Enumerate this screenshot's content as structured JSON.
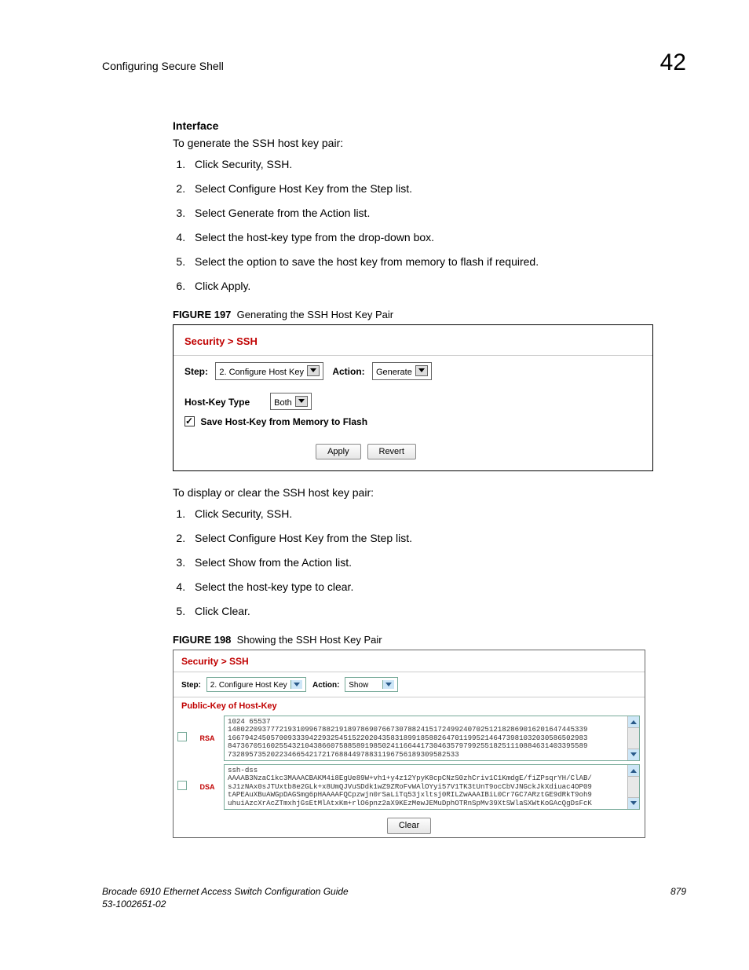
{
  "header": {
    "title": "Configuring Secure Shell",
    "chapter": "42"
  },
  "section": {
    "heading": "Interface",
    "intro1": "To generate the SSH host key pair:",
    "list1": [
      "Click Security, SSH.",
      "Select Configure Host Key from the Step list.",
      "Select Generate from the Action list.",
      "Select the host-key type from the drop-down box.",
      "Select the option to save the host key from memory to flash if required.",
      "Click Apply."
    ],
    "intro2": "To display or clear the SSH host key pair:",
    "list2": [
      "Click Security, SSH.",
      "Select Configure Host Key from the Step list.",
      "Select Show from the Action list.",
      "Select the host-key type to clear.",
      "Click Clear."
    ]
  },
  "figure197": {
    "label": "FIGURE 197",
    "caption": "Generating the SSH Host Key Pair",
    "breadcrumb": "Security > SSH",
    "step_label": "Step:",
    "step_value": "2. Configure Host Key",
    "action_label": "Action:",
    "action_value": "Generate",
    "hostkey_label": "Host-Key Type",
    "hostkey_value": "Both",
    "save_label": "Save Host-Key from Memory to Flash",
    "apply": "Apply",
    "revert": "Revert"
  },
  "figure198": {
    "label": "FIGURE 198",
    "caption": "Showing the SSH Host Key Pair",
    "breadcrumb": "Security > SSH",
    "step_label": "Step:",
    "step_value": "2. Configure Host Key",
    "action_label": "Action:",
    "action_value": "Show",
    "pk_heading": "Public-Key of Host-Key",
    "rsa_label": "RSA",
    "rsa_data": "1024 65537\n148022093777219310996788219189786907667307882415172499240702512182869016201647445339\n166794245057009333942293254515220204358318991858826470119952146473981032030586502983\n847367051602554321043866075885891985024116644173046357979925518251110884631403395589\n732895735202234665421721768844978831196756189309582533",
    "dsa_label": "DSA",
    "dsa_data": "ssh-dss\nAAAAB3NzaC1kc3MAAACBAKM4i8EgUe89W+vh1+y4z12YpyK8cpCNzS0zhCriv1C1KmdgE/fiZPsqrYH/ClAB/\nsJ1zNAx0sJTUxtb8e2GLk+x8UmQJVuSDdk1wZ9ZRoFvWAlOYyi57V1TK3tUnT9ocCbVJNGckJkXdiuac4OP09\ntAPEAuXBuAWGpDAGSmg6pHAAAAFQCpzwjn0rSaLiTq53jxltsj0RILZwAAAIBiL0Cr7GC7ARztGE9dRkT9oh9\nuhuiAzcXrAcZTmxhjGsEtMlAtxKm+rlO6pnz2aX9KEzMewJEMuDphOTRnSpMv39XtSWlaSXWtKoGAcQgDsFcK",
    "clear": "Clear"
  },
  "footer": {
    "left1": "Brocade 6910 Ethernet Access Switch Configuration Guide",
    "left2": "53-1002651-02",
    "page": "879"
  }
}
